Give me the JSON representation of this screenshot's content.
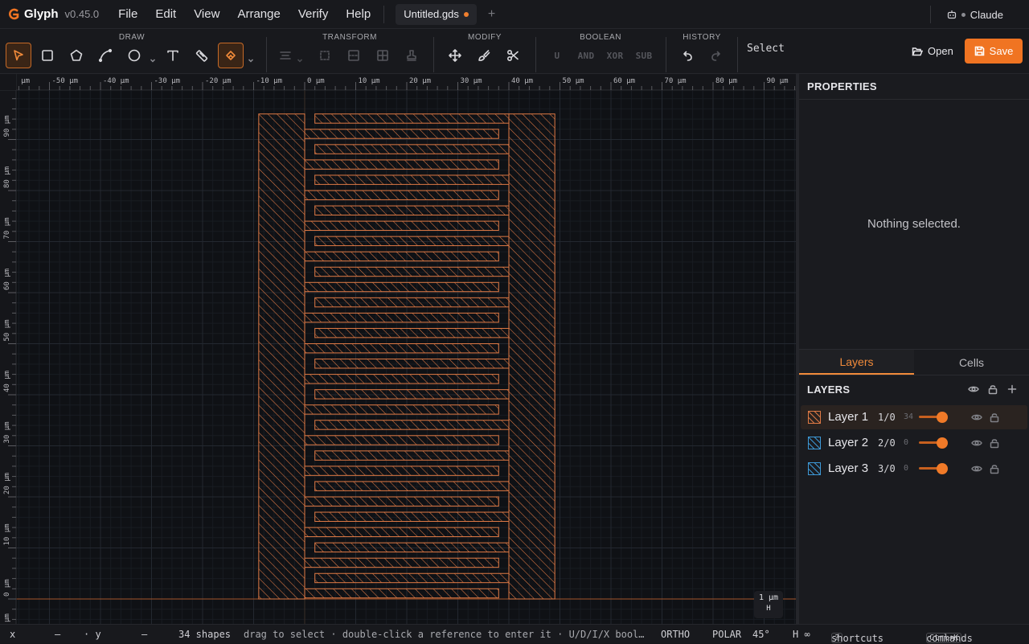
{
  "app": {
    "name": "Glyph",
    "version": "v0.45.0",
    "menus": [
      "File",
      "Edit",
      "View",
      "Arrange",
      "Verify",
      "Help"
    ],
    "tab_title": "Untitled.gds",
    "new_tab_glyph": "+",
    "user": "Claude",
    "accent_color": "#f07422"
  },
  "toolbar": {
    "groups": [
      "DRAW",
      "TRANSFORM",
      "MODIFY",
      "BOOLEAN",
      "HISTORY"
    ],
    "draw_tools": [
      "select-pointer-icon",
      "rectangle-icon",
      "polygon-icon",
      "path-icon",
      "circle-icon",
      "text-icon",
      "ruler-icon",
      "snap-magnet-icon"
    ],
    "active_tool": "snap-magnet-icon",
    "boolean_ops": [
      "U",
      "AND",
      "XOR",
      "SUB"
    ],
    "mode": "Select",
    "open_label": "Open",
    "save_label": "Save"
  },
  "canvas": {
    "unit": "µm",
    "h_ruler_ticks": [
      "-50 µm",
      "-40 µm",
      "-30 µm",
      "-20 µm",
      "-10 µm",
      "0 µm",
      "10 µm",
      "20 µm",
      "30 µm",
      "40 µm",
      "50 µm",
      "60 µm",
      "70 µm",
      "80 µm",
      "90 µm"
    ],
    "v_ruler_ticks": [
      "90 µm",
      "80 µm",
      "70 µm",
      "60 µm",
      "50 µm",
      "40 µm",
      "30 µm",
      "20 µm",
      "10 µm",
      "0 µm"
    ],
    "scale_label": "1 µm",
    "scale_sub": "H",
    "layout_color": "#e07a45"
  },
  "properties": {
    "title": "PROPERTIES",
    "empty_message": "Nothing selected."
  },
  "panel_tabs": [
    "Layers",
    "Cells"
  ],
  "layers": {
    "title": "LAYERS",
    "items": [
      {
        "name": "Layer 1",
        "id": "1/0",
        "count": "34",
        "color": "#e07a45",
        "opacity": 0.8,
        "active": true
      },
      {
        "name": "Layer 2",
        "id": "2/0",
        "count": "0",
        "color": "#3e9ad8",
        "opacity": 0.8,
        "active": false
      },
      {
        "name": "Layer 3",
        "id": "3/0",
        "count": "0",
        "color": "#3e9ad8",
        "opacity": 0.8,
        "active": false
      }
    ]
  },
  "status": {
    "x_label": "x",
    "x_value": "—",
    "y_label": "· y",
    "y_value": "—",
    "shapes": "34 shapes",
    "hint": "drag to select · double-click a reference to enter it · U/D/I/X bool…",
    "ortho": "ORTHO",
    "polar": "POLAR",
    "angle": "45°",
    "h_value": "H ∞",
    "shortcuts_key": "?",
    "shortcuts_label": "shortcuts",
    "commands_key": "Ctrl+K",
    "commands_label": "commands"
  }
}
